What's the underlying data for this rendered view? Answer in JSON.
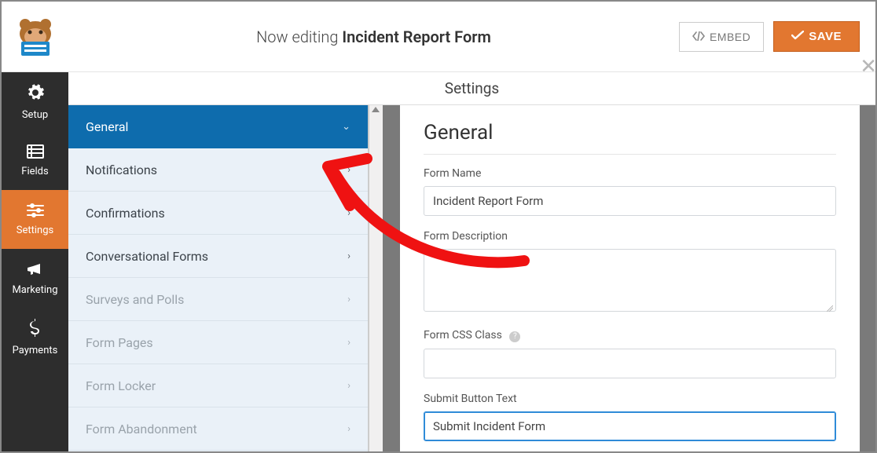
{
  "header": {
    "now_editing_prefix": "Now editing ",
    "form_title": "Incident Report Form",
    "embed_label": "EMBED",
    "save_label": "SAVE"
  },
  "rail": {
    "items": [
      {
        "id": "setup",
        "label": "Setup",
        "icon": "gear-icon"
      },
      {
        "id": "fields",
        "label": "Fields",
        "icon": "list-icon"
      },
      {
        "id": "settings",
        "label": "Settings",
        "icon": "sliders-icon",
        "active": true
      },
      {
        "id": "marketing",
        "label": "Marketing",
        "icon": "bullhorn-icon"
      },
      {
        "id": "payments",
        "label": "Payments",
        "icon": "dollar-icon"
      }
    ]
  },
  "settings_title": "Settings",
  "panels": [
    {
      "label": "General",
      "open": true,
      "active": true
    },
    {
      "label": "Notifications"
    },
    {
      "label": "Confirmations"
    },
    {
      "label": "Conversational Forms"
    },
    {
      "label": "Surveys and Polls",
      "disabled": true
    },
    {
      "label": "Form Pages",
      "disabled": true
    },
    {
      "label": "Form Locker",
      "disabled": true
    },
    {
      "label": "Form Abandonment",
      "disabled": true
    }
  ],
  "form": {
    "heading": "General",
    "name_label": "Form Name",
    "name_value": "Incident Report Form",
    "description_label": "Form Description",
    "description_value": "",
    "css_label": "Form CSS Class",
    "css_value": "",
    "submit_label": "Submit Button Text",
    "submit_value": "Submit Incident Form"
  },
  "colors": {
    "accent": "#e27730",
    "primary_blue": "#0e6cad",
    "rail_bg": "#2d2d2d"
  }
}
